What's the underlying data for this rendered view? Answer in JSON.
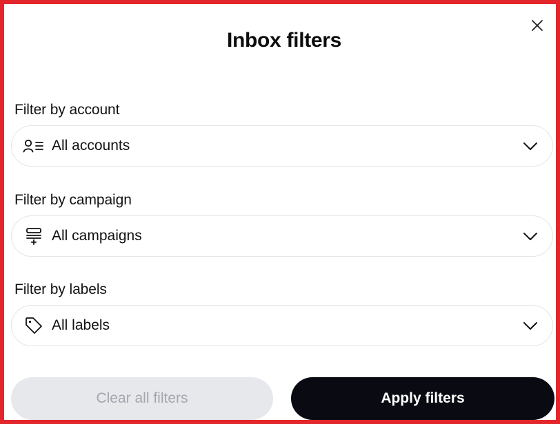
{
  "dialog": {
    "title": "Inbox filters",
    "close_icon": "close-icon"
  },
  "filters": [
    {
      "label": "Filter by account",
      "value": "All accounts",
      "icon": "accounts-list-icon"
    },
    {
      "label": "Filter by campaign",
      "value": "All campaigns",
      "icon": "campaign-stack-icon"
    },
    {
      "label": "Filter by labels",
      "value": "All labels",
      "icon": "tag-icon"
    }
  ],
  "actions": {
    "clear_label": "Clear all filters",
    "apply_label": "Apply filters"
  },
  "colors": {
    "border_accent": "#e3262b",
    "apply_bg": "#0a0b12",
    "clear_bg": "#e6e8ec",
    "clear_text": "#a3a6ae",
    "select_border": "#e4e5e8"
  }
}
